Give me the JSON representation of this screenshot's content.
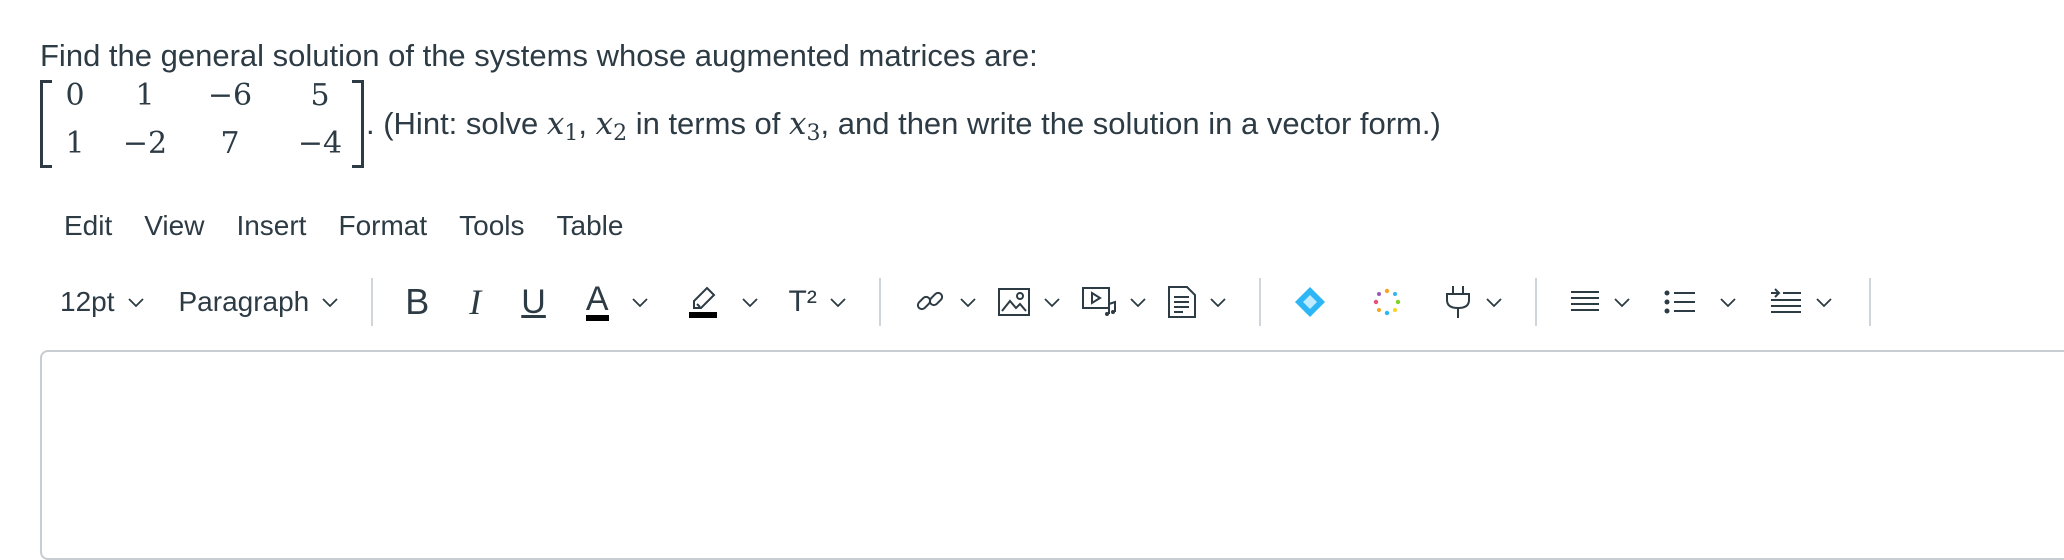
{
  "question": {
    "line1": "Find the general solution of the systems whose augmented matrices are:",
    "matrix": [
      [
        "0",
        "1",
        "−6",
        "5"
      ],
      [
        "1",
        "−2",
        "7",
        "−4"
      ]
    ],
    "hint_pre": ". (Hint: solve ",
    "x": "x",
    "sub1": "1",
    "comma": ", ",
    "sub2": "2",
    "hint_mid": " in terms of ",
    "sub3": "3",
    "hint_post": ", and then write the solution in a vector form.)"
  },
  "menubar": {
    "items": [
      "Edit",
      "View",
      "Insert",
      "Format",
      "Tools",
      "Table"
    ]
  },
  "toolbar": {
    "font_size": "12pt",
    "block_format": "Paragraph",
    "bold": "B",
    "italic": "I",
    "underline": "U",
    "text_color_glyph": "A",
    "superscript_glyph": "T²"
  },
  "colors": {
    "text": "#2d3b45",
    "border": "#c7cdd1",
    "accent_blue": "#2db6f5"
  }
}
